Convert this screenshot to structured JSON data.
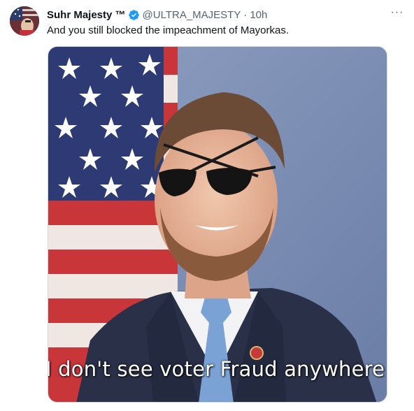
{
  "tweet": {
    "display_name": "Suhr Majesty ™",
    "handle": "@ULTRA_MAJESTY",
    "separator": "·",
    "time": "10h",
    "more_label": "···",
    "text": "And you still blocked the impeachment of Mayorkas.",
    "verified": true,
    "media": {
      "icon": "photo",
      "caption": "I don't see voter Fraud anywhere"
    }
  },
  "colors": {
    "verified_blue": "#1d9bf0",
    "text_primary": "#0f1419",
    "text_secondary": "#536471",
    "border": "#cfd9de"
  }
}
